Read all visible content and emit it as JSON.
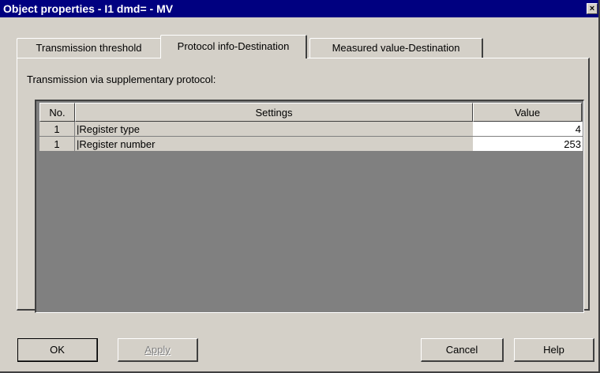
{
  "window": {
    "title": "Object properties - I1 dmd= - MV",
    "close_glyph": "×"
  },
  "tabs": [
    {
      "label": "Transmission threshold",
      "active": false
    },
    {
      "label": "Protocol info-Destination",
      "active": true
    },
    {
      "label": "Measured value-Destination",
      "active": false
    }
  ],
  "panel": {
    "caption": "Transmission via supplementary protocol:"
  },
  "grid": {
    "columns": {
      "no": "No.",
      "settings": "Settings",
      "value": "Value"
    },
    "rows": [
      {
        "no": "1",
        "setting": "|Register type",
        "value": "4"
      },
      {
        "no": "1",
        "setting": "|Register number",
        "value": "253"
      }
    ]
  },
  "buttons": {
    "ok": "OK",
    "apply": "Apply",
    "cancel": "Cancel",
    "help": "Help"
  },
  "colors": {
    "title_bar": "#000080",
    "face": "#d4d0c8",
    "grid_background": "#808080"
  }
}
